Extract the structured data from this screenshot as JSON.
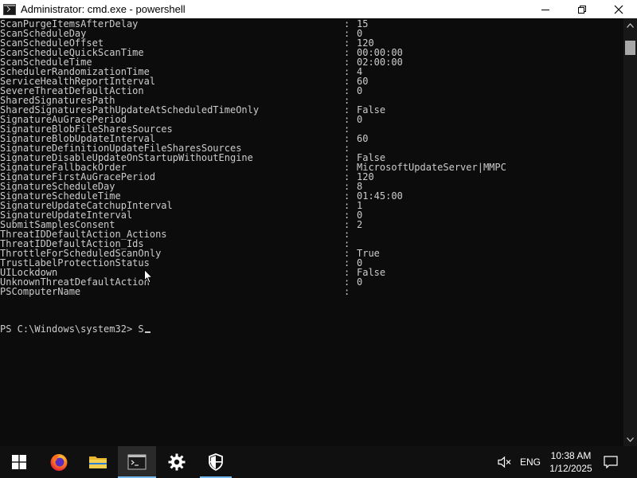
{
  "window": {
    "title": "Administrator: cmd.exe - powershell",
    "controls": {
      "minimize": "minimize",
      "maximize": "maximize",
      "close": "close"
    }
  },
  "console": {
    "lines": [
      {
        "key": "ScanPurgeItemsAfterDelay",
        "sep": ":",
        "value": "15"
      },
      {
        "key": "ScanScheduleDay",
        "sep": ":",
        "value": "0"
      },
      {
        "key": "ScanScheduleOffset",
        "sep": ":",
        "value": "120"
      },
      {
        "key": "ScanScheduleQuickScanTime",
        "sep": ":",
        "value": "00:00:00"
      },
      {
        "key": "ScanScheduleTime",
        "sep": ":",
        "value": "02:00:00"
      },
      {
        "key": "SchedulerRandomizationTime",
        "sep": ":",
        "value": "4"
      },
      {
        "key": "ServiceHealthReportInterval",
        "sep": ":",
        "value": "60"
      },
      {
        "key": "SevereThreatDefaultAction",
        "sep": ":",
        "value": "0"
      },
      {
        "key": "SharedSignaturesPath",
        "sep": ":",
        "value": ""
      },
      {
        "key": "SharedSignaturesPathUpdateAtScheduledTimeOnly",
        "sep": ":",
        "value": "False"
      },
      {
        "key": "SignatureAuGracePeriod",
        "sep": ":",
        "value": "0"
      },
      {
        "key": "SignatureBlobFileSharesSources",
        "sep": ":",
        "value": ""
      },
      {
        "key": "SignatureBlobUpdateInterval",
        "sep": ":",
        "value": "60"
      },
      {
        "key": "SignatureDefinitionUpdateFileSharesSources",
        "sep": ":",
        "value": ""
      },
      {
        "key": "SignatureDisableUpdateOnStartupWithoutEngine",
        "sep": ":",
        "value": "False"
      },
      {
        "key": "SignatureFallbackOrder",
        "sep": ":",
        "value": "MicrosoftUpdateServer|MMPC"
      },
      {
        "key": "SignatureFirstAuGracePeriod",
        "sep": ":",
        "value": "120"
      },
      {
        "key": "SignatureScheduleDay",
        "sep": ":",
        "value": "8"
      },
      {
        "key": "SignatureScheduleTime",
        "sep": ":",
        "value": "01:45:00"
      },
      {
        "key": "SignatureUpdateCatchupInterval",
        "sep": ":",
        "value": "1"
      },
      {
        "key": "SignatureUpdateInterval",
        "sep": ":",
        "value": "0"
      },
      {
        "key": "SubmitSamplesConsent",
        "sep": ":",
        "value": "2"
      },
      {
        "key": "ThreatIDDefaultAction_Actions",
        "sep": ":",
        "value": ""
      },
      {
        "key": "ThreatIDDefaultAction_Ids",
        "sep": ":",
        "value": ""
      },
      {
        "key": "ThrottleForScheduledScanOnly",
        "sep": ":",
        "value": "True"
      },
      {
        "key": "TrustLabelProtectionStatus",
        "sep": ":",
        "value": "0"
      },
      {
        "key": "UILockdown",
        "sep": ":",
        "value": "False"
      },
      {
        "key": "UnknownThreatDefaultAction",
        "sep": ":",
        "value": "0"
      },
      {
        "key": "PSComputerName",
        "sep": ":",
        "value": ""
      }
    ],
    "prompt": "PS C:\\Windows\\system32> S"
  },
  "taskbar": {
    "pinned": [
      {
        "name": "start-button",
        "icon": "windows-logo-icon"
      },
      {
        "name": "firefox-button",
        "icon": "firefox-icon"
      },
      {
        "name": "file-explorer-button",
        "icon": "folder-icon"
      },
      {
        "name": "cmd-button",
        "icon": "terminal-icon",
        "active": true
      },
      {
        "name": "settings-button",
        "icon": "gear-icon"
      },
      {
        "name": "security-button",
        "icon": "shield-icon"
      }
    ],
    "tray": {
      "volume_icon": "volume-muted-icon",
      "language": "ENG",
      "time": "10:38 AM",
      "date": "1/12/2025",
      "notification_icon": "notification-icon"
    }
  },
  "colors": {
    "console_bg": "#0c0c0c",
    "console_fg": "#cccccc",
    "accent": "#76b9ed"
  }
}
